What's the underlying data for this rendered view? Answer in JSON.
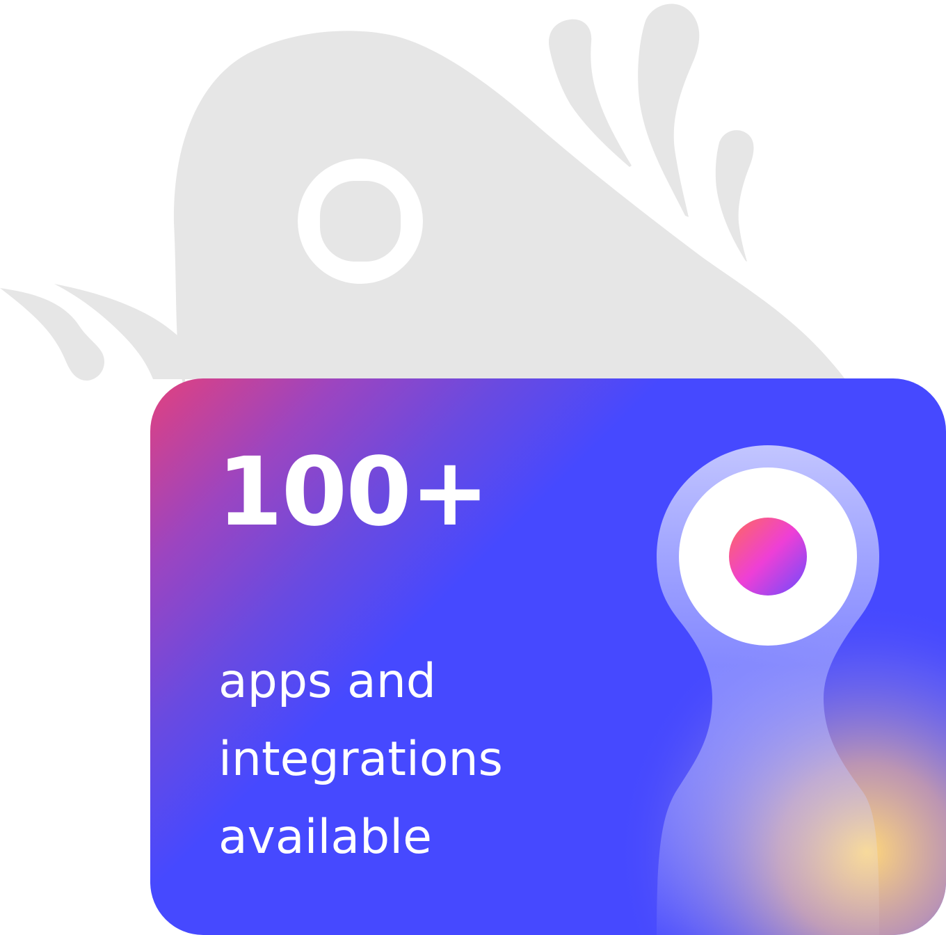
{
  "stat": {
    "number": "100+",
    "caption": "apps and integrations available"
  },
  "icons": {
    "background": "creature-silhouette-icon",
    "card": "creature-eye-icon"
  },
  "colors": {
    "silhouette": "#e6e6e6",
    "card_blue": "#4649ff",
    "card_pink": "#e2417e",
    "glow_yellow": "#ffd77a",
    "pupil_pink": "#ff4fa3"
  }
}
